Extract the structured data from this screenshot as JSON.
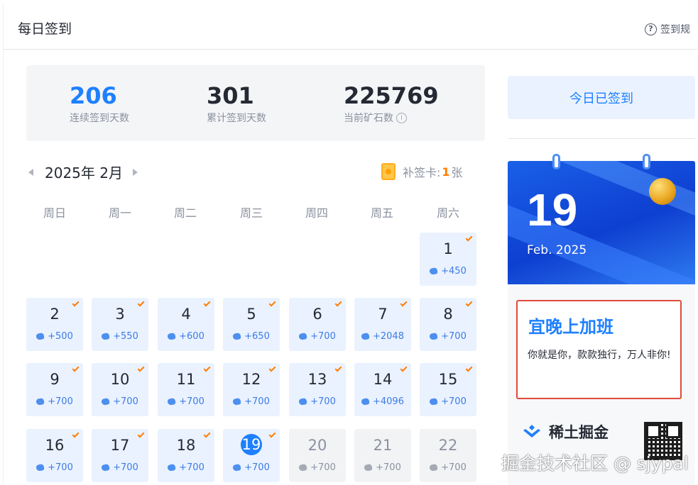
{
  "header": {
    "title": "每日签到",
    "rules_link": "签到规",
    "help_icon": "question-circle"
  },
  "stats": [
    {
      "value": "206",
      "label": "连续签到天数"
    },
    {
      "value": "301",
      "label": "累计签到天数"
    },
    {
      "value": "225769",
      "label": "当前矿石数",
      "info_icon": "i"
    }
  ],
  "calendar": {
    "month_label": "2025年 2月",
    "makeup_label": "补签卡:",
    "makeup_count": "1",
    "makeup_unit": "张",
    "weekdays": [
      "周日",
      "周一",
      "周二",
      "周三",
      "周四",
      "周五",
      "周六"
    ],
    "days": [
      {
        "day": "1",
        "reward": "+450",
        "signed": true
      },
      {
        "day": "2",
        "reward": "+500",
        "signed": true
      },
      {
        "day": "3",
        "reward": "+550",
        "signed": true
      },
      {
        "day": "4",
        "reward": "+600",
        "signed": true
      },
      {
        "day": "5",
        "reward": "+650",
        "signed": true
      },
      {
        "day": "6",
        "reward": "+700",
        "signed": true
      },
      {
        "day": "7",
        "reward": "+2048",
        "signed": true
      },
      {
        "day": "8",
        "reward": "+700",
        "signed": true
      },
      {
        "day": "9",
        "reward": "+700",
        "signed": true
      },
      {
        "day": "10",
        "reward": "+700",
        "signed": true
      },
      {
        "day": "11",
        "reward": "+700",
        "signed": true
      },
      {
        "day": "12",
        "reward": "+700",
        "signed": true
      },
      {
        "day": "13",
        "reward": "+700",
        "signed": true
      },
      {
        "day": "14",
        "reward": "+4096",
        "signed": true
      },
      {
        "day": "15",
        "reward": "+700",
        "signed": true
      },
      {
        "day": "16",
        "reward": "+700",
        "signed": true
      },
      {
        "day": "17",
        "reward": "+700",
        "signed": true
      },
      {
        "day": "18",
        "reward": "+700",
        "signed": true
      },
      {
        "day": "19",
        "reward": "+700",
        "signed": true,
        "today": true
      },
      {
        "day": "20",
        "reward": "+700",
        "signed": false
      },
      {
        "day": "21",
        "reward": "+700",
        "signed": false
      },
      {
        "day": "22",
        "reward": "+700",
        "signed": false
      }
    ]
  },
  "sidebar": {
    "signed_button": "今日已签到",
    "date_card": {
      "day": "19",
      "month_year": "Feb. 2025",
      "fortune_title": "宜晚上加班",
      "fortune_text": "你就是你，款款独行，万人非你!"
    },
    "brand": "稀土掘金"
  },
  "watermark": "掘金技术社区 @ sjypal",
  "colors": {
    "accent": "#1e80ff",
    "check": "#ff7d00",
    "signed_bg": "#eaf2ff",
    "future_bg": "#f2f3f5",
    "fortune_border": "#e04a3a"
  }
}
